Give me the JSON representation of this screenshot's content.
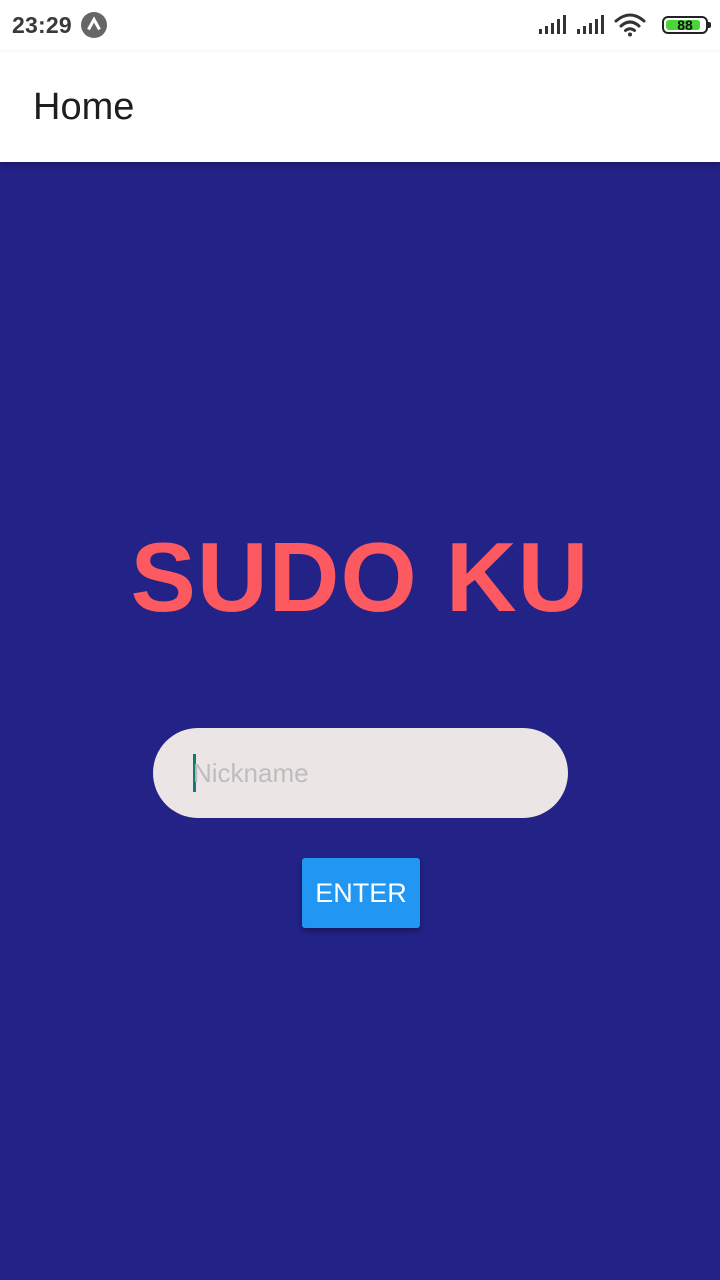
{
  "status_bar": {
    "time": "23:29",
    "battery_level": "88",
    "icons": [
      "notification-a-icon",
      "signal-icon",
      "signal-icon",
      "wifi-icon",
      "battery-icon"
    ]
  },
  "app_bar": {
    "title": "Home"
  },
  "main": {
    "game_title": "SUDO KU",
    "nickname_placeholder": "Nickname",
    "nickname_value": "",
    "enter_label": "ENTER"
  },
  "colors": {
    "background": "#232287",
    "title": "#fc5961",
    "input_bg": "#ebe5e5",
    "button": "#2196f3",
    "app_bar": "#ffffff"
  }
}
